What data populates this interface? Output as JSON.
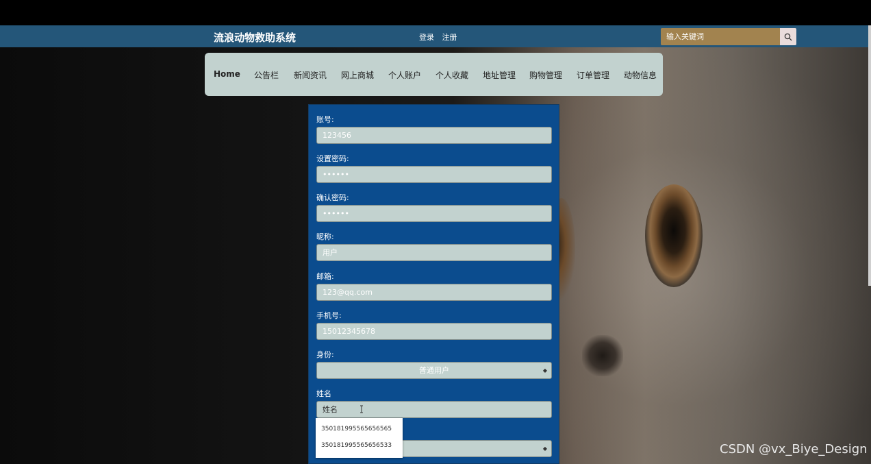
{
  "header": {
    "site_title": "流浪动物救助系统",
    "login": "登录",
    "register": "注册",
    "search_placeholder": "输入关键词"
  },
  "nav": {
    "items": [
      "Home",
      "公告栏",
      "新闻资讯",
      "网上商城",
      "个人账户",
      "个人收藏",
      "地址管理",
      "购物管理",
      "订单管理",
      "动物信息"
    ]
  },
  "form": {
    "account_label": "账号:",
    "account_value": "123456",
    "password_label": "设置密码:",
    "password_value": "••••••",
    "confirm_label": "确认密码:",
    "confirm_value": "••••••",
    "nickname_label": "昵称:",
    "nickname_value": "用户",
    "email_label": "邮箱:",
    "email_value": "123@qq.com",
    "phone_label": "手机号:",
    "phone_value": "15012345678",
    "role_label": "身份:",
    "role_value": "普通用户",
    "name_label": "姓名",
    "name_value": "姓名"
  },
  "autocomplete": {
    "items": [
      "350181995565656565",
      "350181995565656533"
    ]
  },
  "watermark": "CSDN @vx_Biye_Design",
  "colors": {
    "header_bg": "#245679",
    "nav_bg": "#c2d2cf",
    "form_bg": "#0b4c8e",
    "search_bg": "#a2834f"
  }
}
